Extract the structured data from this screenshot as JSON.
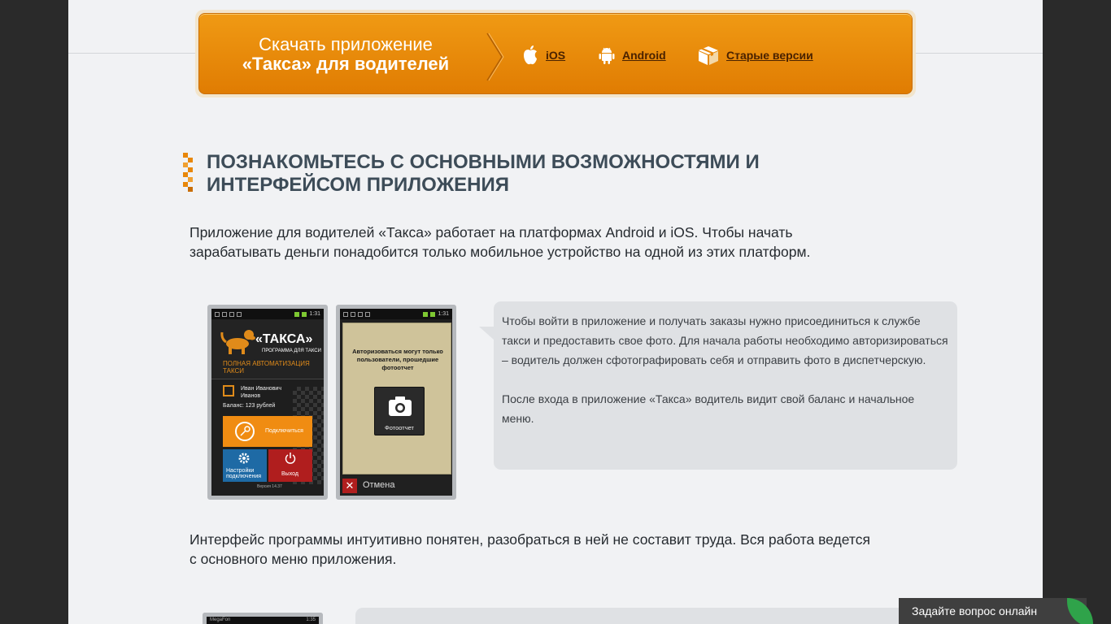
{
  "banner": {
    "title_line1": "Скачать приложение",
    "title_line2": "«Такса» для водителей",
    "links": [
      {
        "label": "iOS",
        "icon": "apple-icon"
      },
      {
        "label": "Android",
        "icon": "android-icon"
      },
      {
        "label": "Старые версии",
        "icon": "box-icon"
      }
    ]
  },
  "heading": {
    "line1": "ПОЗНАКОМЬТЕСЬ С ОСНОВНЫМИ ВОЗМОЖНОСТЯМИ И",
    "line2": "ИНТЕРФЕЙСОМ ПРИЛОЖЕНИЯ"
  },
  "intro": {
    "line1": "Приложение для водителей «Такса» работает на платформах Android и iOS. Чтобы начать",
    "line2": "зарабатывать деньги понадобится только мобильное устройство на одной из этих платформ."
  },
  "phone1": {
    "time": "1:31",
    "brand": "«ТАКСА»",
    "subtitle": "ПРОГРАММА ДЛЯ ТАКСИ",
    "tagline": "ПОЛНАЯ АВТОМАТИЗАЦИЯ ТАКСИ",
    "user_first": "Иван Иванович",
    "user_last": "Иванов",
    "balance": "Баланс:  123 рублей",
    "connect": "Подключиться",
    "settings_line1": "Настройки",
    "settings_line2": "подключения",
    "exit": "Выход",
    "version": "Версия 14.37"
  },
  "phone2": {
    "time": "1:31",
    "message": "Авторизоваться могут только пользователи, прошедшие фотоотчет",
    "photo_button": "Фотоотчет",
    "cancel": "Отмена"
  },
  "bubble": {
    "p1": "Чтобы войти в приложение и получать заказы нужно присоединиться к службе такси и предоставить свое фото. Для начала работы необходимо авторизироваться – водитель должен сфотографировать себя и отправить фото в диспетчерскую.",
    "p2": "После входа в приложение «Такса» водитель видит свой баланс и начальное меню."
  },
  "para2": {
    "line1": "Интерфейс программы интуитивно понятен, разобраться в ней не составит труда. Вся работа ведется",
    "line2": "с основного меню приложения."
  },
  "phone3": {
    "carrier": "MegaFon",
    "time": "1:35"
  },
  "chat": {
    "label": "Задайте вопрос онлайн"
  },
  "colors": {
    "accent": "#e8870a",
    "heading": "#3d4c58",
    "chat_accent": "#2fa34a"
  }
}
